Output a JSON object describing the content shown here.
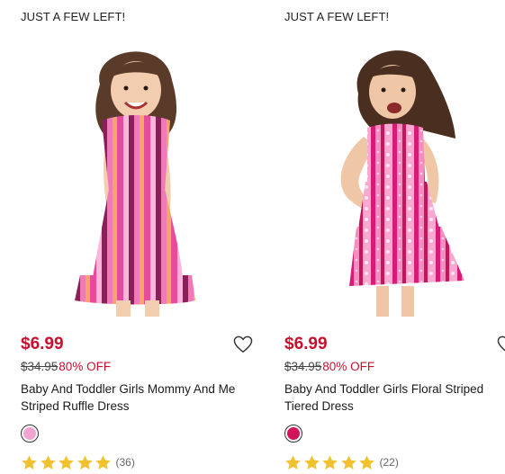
{
  "colors": {
    "sale": "#c8102e",
    "star": "#f2c12e"
  },
  "products": [
    {
      "badge": "JUST A FEW LEFT!",
      "price": "$6.99",
      "original_price": "$34.95",
      "discount": "80% OFF",
      "name": "Baby And Toddler Girls Mommy And Me Striped Ruffle Dress",
      "swatch_color": "#f2a3d0",
      "rating": 5,
      "review_count": "(36)",
      "wishlist_icon": "heart-outline-icon"
    },
    {
      "badge": "JUST A FEW LEFT!",
      "price": "$6.99",
      "original_price": "$34.95",
      "discount": "80% OFF",
      "name": "Baby And Toddler Girls Floral Striped Tiered Dress",
      "swatch_color": "#d4145a",
      "rating": 5,
      "review_count": "(22)",
      "wishlist_icon": "heart-outline-icon"
    }
  ]
}
